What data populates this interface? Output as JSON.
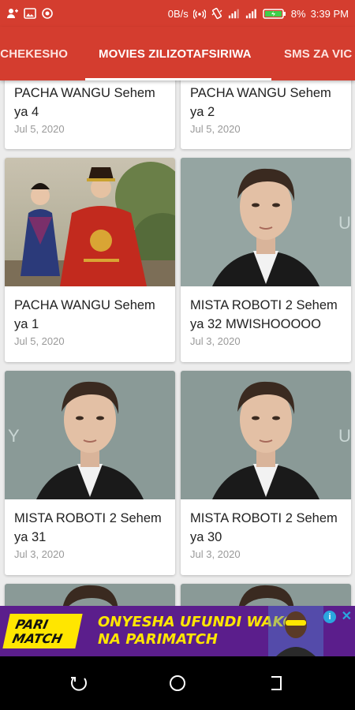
{
  "status_bar": {
    "net_speed": "0B/s",
    "battery": "8%",
    "time": "3:39 PM",
    "icons": [
      "person-add-icon",
      "gallery-icon",
      "record-icon",
      "hotspot-icon",
      "vibrate-icon",
      "signal-icon",
      "signal-icon",
      "battery-icon"
    ]
  },
  "tabs": [
    {
      "label": "ICHEKESHO",
      "active": false
    },
    {
      "label": "MOVIES ZILIZOTAFSIRIWA",
      "active": true
    },
    {
      "label": "SMS ZA VIC",
      "active": false
    }
  ],
  "cards": [
    {
      "title": "PACHA WANGU Sehem ya 4",
      "date": "Jul 5, 2020",
      "thumb": "none"
    },
    {
      "title": "PACHA WANGU Sehem ya 2",
      "date": "Jul 5, 2020",
      "thumb": "none"
    },
    {
      "title": "PACHA WANGU Sehem ya 1",
      "date": "Jul 5, 2020",
      "thumb": "royal-couple-poster"
    },
    {
      "title": "MISTA ROBOTI 2 Sehem ya 32 MWISHOOOOO",
      "date": "Jul 3, 2020",
      "thumb": "actor-portrait"
    },
    {
      "title": "MISTA ROBOTI 2 Sehem ya 31",
      "date": "Jul 3, 2020",
      "thumb": "actor-portrait"
    },
    {
      "title": "MISTA ROBOTI 2 Sehem ya 30",
      "date": "Jul 3, 2020",
      "thumb": "actor-portrait"
    },
    {
      "title": "",
      "date": "",
      "thumb": "actor-portrait"
    },
    {
      "title": "",
      "date": "",
      "thumb": "actor-portrait"
    }
  ],
  "ad": {
    "logo_top": "PARI",
    "logo_bottom": "MATCH",
    "line1": "ONYESHA UFUNDI WAKO",
    "line2": "NA PARIMATCH",
    "info": "i",
    "close": "✕"
  },
  "colors": {
    "primary": "#d43d2f",
    "ad_bg": "#5b1e8c",
    "ad_accent": "#ffe600"
  }
}
